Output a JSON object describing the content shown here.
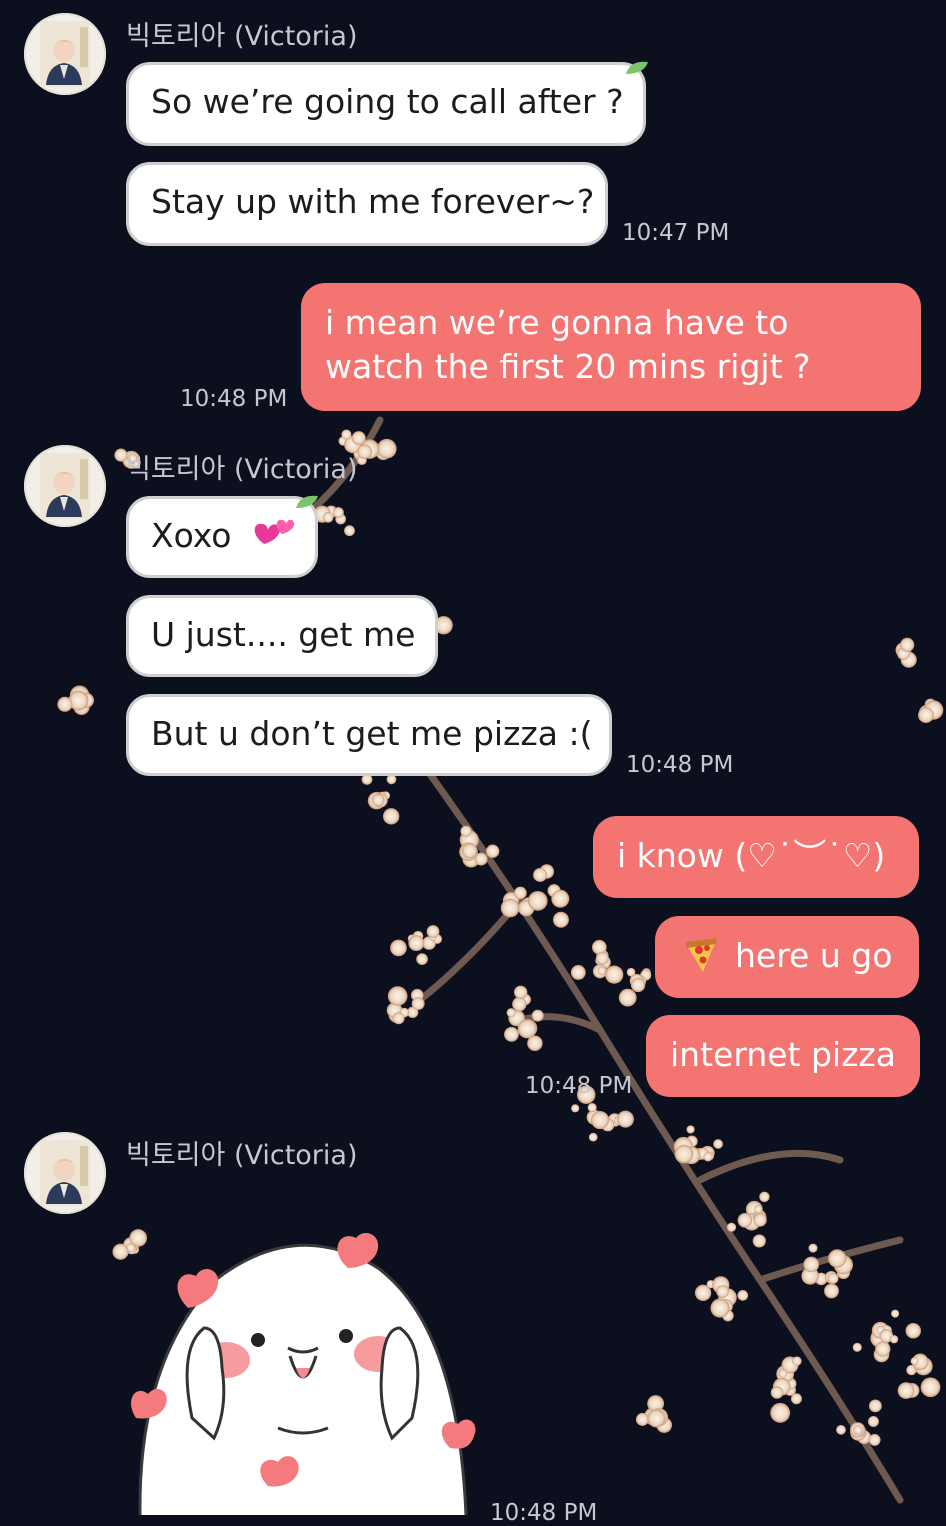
{
  "chat": {
    "sender_name": "빅토리아 (Victoria)",
    "groups": [
      {
        "incoming": [
          "So we’re going to call after ?",
          "Stay up with me forever~?"
        ],
        "time": "10:47 PM"
      },
      {
        "outgoing": [
          "i mean we’re gonna have to watch the first 20 mins rigjt ?"
        ],
        "time": "10:48 PM"
      },
      {
        "incoming": [
          "Xoxo",
          "U just.... get me",
          "But u don’t get me pizza :("
        ],
        "time": "10:48 PM"
      },
      {
        "outgoing": [
          "i know (♡˙︶˙♡)",
          "here u go",
          "internet pizza"
        ],
        "time": "10:48 PM"
      },
      {
        "sticker": "hearts-blob-sticker",
        "time": "10:48 PM"
      }
    ]
  },
  "icons": {
    "avatar": "avatar-icon",
    "emoji_hearts": "two-hearts-emoji",
    "emoji_pizza": "pizza-emoji",
    "leaf": "leaf-icon"
  },
  "colors": {
    "background": "#0c0f1e",
    "incoming_bubble": "#ffffff",
    "outgoing_bubble": "#f47472",
    "leaf": "#7cc46a",
    "blossom": "#f3e4d4"
  }
}
